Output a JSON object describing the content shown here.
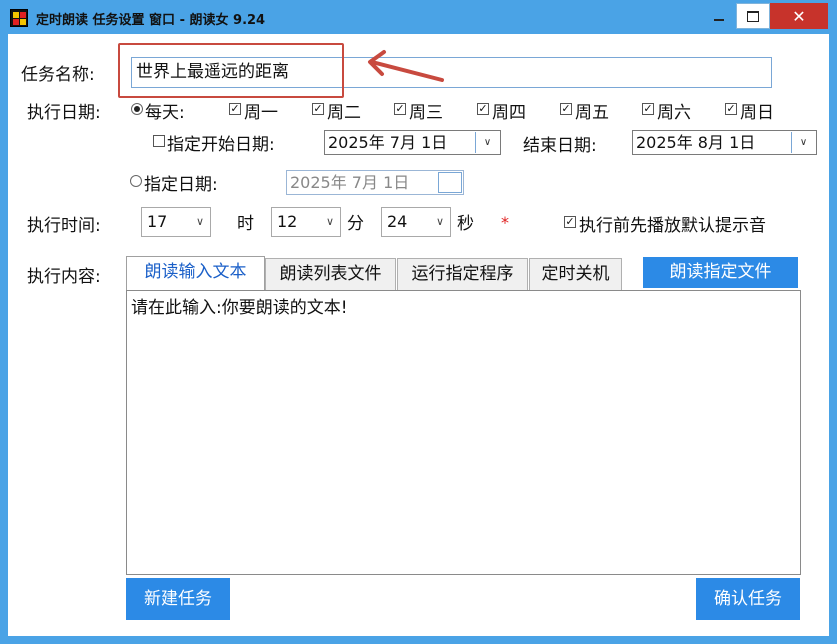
{
  "window": {
    "title": "定时朗读 任务设置 窗口 - 朗读女 9.24",
    "close_glyph": "✕"
  },
  "task_name": {
    "label": "任务名称:",
    "value": "世界上最遥远的距离"
  },
  "exec_date": {
    "label": "执行日期:",
    "every_day_label": "每天:",
    "weekdays": [
      {
        "label": "周一",
        "checked": true
      },
      {
        "label": "周二",
        "checked": true
      },
      {
        "label": "周三",
        "checked": true
      },
      {
        "label": "周四",
        "checked": true
      },
      {
        "label": "周五",
        "checked": true
      },
      {
        "label": "周六",
        "checked": true
      },
      {
        "label": "周日",
        "checked": true
      }
    ],
    "start_date_label": "指定开始日期:",
    "start_date_value": "2025年 7月 1日",
    "end_date_label": "结束日期:",
    "end_date_value": "2025年 8月 1日",
    "specific_date_label": "指定日期:",
    "specific_date_value": "2025年 7月 1日"
  },
  "exec_time": {
    "label": "执行时间:",
    "hour": "17",
    "hour_unit": "时",
    "minute": "12",
    "minute_unit": "分",
    "second": "24",
    "second_unit": "秒",
    "required_mark": "*",
    "play_sound_label": "执行前先播放默认提示音",
    "play_sound_checked": true
  },
  "content": {
    "label": "执行内容:",
    "tabs": [
      {
        "label": "朗读输入文本",
        "active": true
      },
      {
        "label": "朗读列表文件",
        "active": false
      },
      {
        "label": "运行指定程序",
        "active": false
      },
      {
        "label": "定时关机",
        "active": false
      }
    ],
    "read_file_button": "朗读指定文件",
    "text_value": "请在此输入:你要朗读的文本!"
  },
  "buttons": {
    "new_task": "新建任务",
    "confirm_task": "确认任务"
  },
  "check_glyph": "✓",
  "dropdown_glyph": "∨",
  "colors": {
    "titlebar": "#4aa3e6",
    "accent_button": "#2c8ae6",
    "close_button": "#c7332b",
    "annotation": "#c84a3f",
    "required": "#e02020"
  }
}
